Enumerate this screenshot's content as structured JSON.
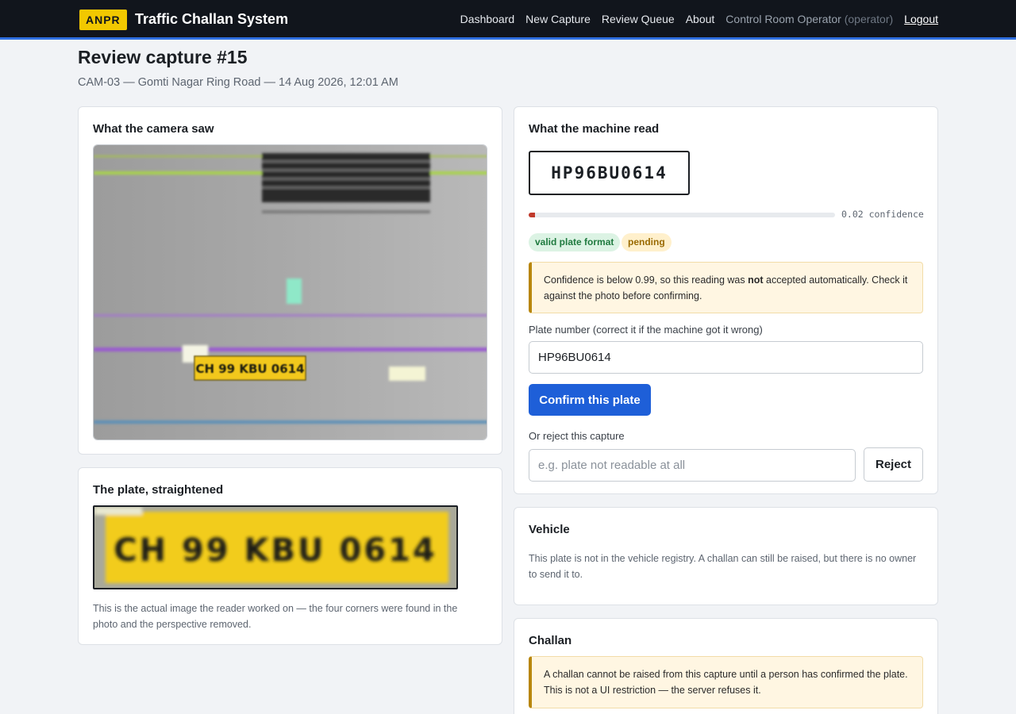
{
  "brand": {
    "badge": "ANPR",
    "name": "Traffic Challan System"
  },
  "nav": {
    "items": [
      "Dashboard",
      "New Capture",
      "Review Queue",
      "About"
    ],
    "user_name": "Control Room Operator",
    "user_role": "(operator)",
    "logout": "Logout"
  },
  "page": {
    "title": "Review capture #15",
    "subtitle": "CAM-03 — Gomti Nagar Ring Road — 14 Aug 2026, 12:01 AM"
  },
  "camera_card": {
    "title": "What the camera saw",
    "plate_text_in_photo": "CH 99 KBU 0614"
  },
  "plate_card": {
    "title": "The plate, straightened",
    "plate_text": "CH 99 KBU 0614",
    "caption": "This is the actual image the reader worked on — the four corners were found in the photo and the perspective removed."
  },
  "machine_card": {
    "title": "What the machine read",
    "plate_read": "HP96BU0614",
    "confidence": 0.02,
    "confidence_label": "0.02 confidence",
    "badges": {
      "valid": "valid plate format",
      "status": "pending"
    },
    "warning_pre": "Confidence is below 0.99, so this reading was ",
    "warning_bold": "not",
    "warning_post": " accepted automatically. Check it against the photo before confirming.",
    "plate_input_label": "Plate number (correct it if the machine got it wrong)",
    "plate_input_value": "HP96BU0614",
    "confirm_label": "Confirm this plate",
    "reject_label_heading": "Or reject this capture",
    "reject_placeholder": "e.g. plate not readable at all",
    "reject_button": "Reject"
  },
  "vehicle_card": {
    "title": "Vehicle",
    "text": "This plate is not in the vehicle registry. A challan can still be raised, but there is no owner to send it to."
  },
  "challan_card": {
    "title": "Challan",
    "warning": "A challan cannot be raised from this capture until a person has confirmed the plate. This is not a UI restriction — the server refuses it."
  },
  "colors": {
    "topbar": "#11151c",
    "accent": "#2f6fe0",
    "brand_yellow": "#f2c800",
    "primary_button": "#1e5fd8",
    "confidence_low": "#c0392b"
  }
}
